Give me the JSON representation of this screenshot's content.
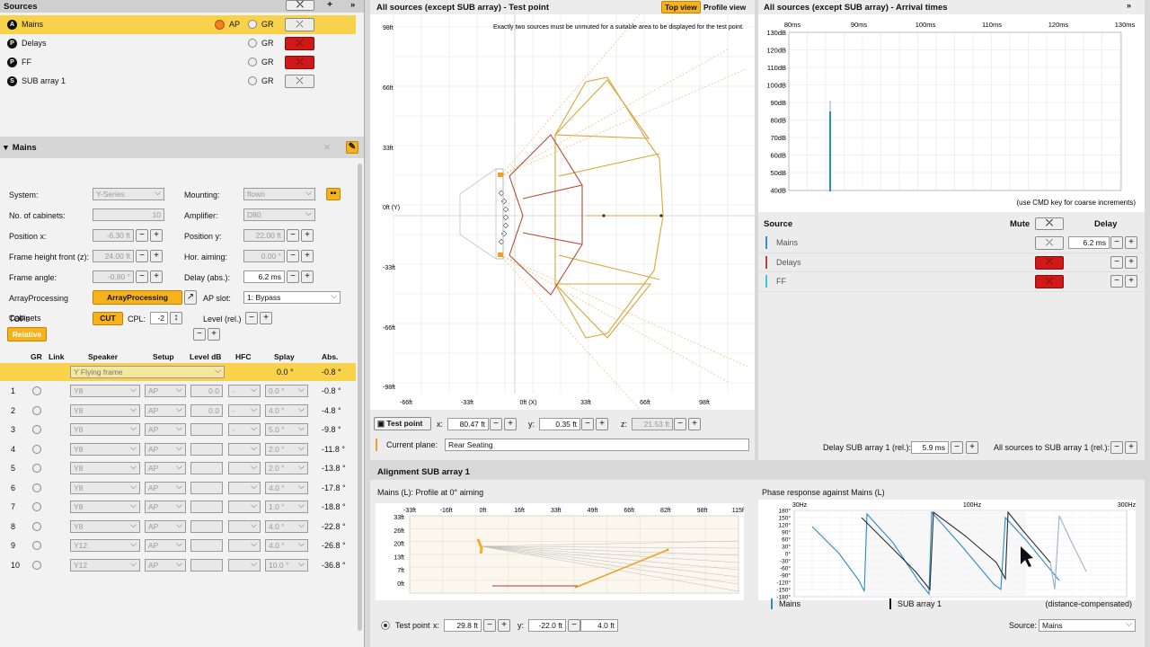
{
  "sources": {
    "title": "Sources",
    "items": [
      {
        "badge": "A",
        "name": "Mains",
        "ap": "AP",
        "gr": "GR",
        "selected": true
      },
      {
        "badge": "P",
        "name": "Delays",
        "gr": "GR"
      },
      {
        "badge": "P",
        "name": "FF",
        "gr": "GR"
      },
      {
        "badge": "S",
        "name": "SUB array 1",
        "gr": "GR"
      }
    ]
  },
  "mains": {
    "title": "Mains",
    "system_label": "System:",
    "system": "Y-Series",
    "mounting_label": "Mounting:",
    "mounting": "flown",
    "cabinets_label": "No. of cabinets:",
    "cabinets": "10",
    "amplifier_label": "Amplifier:",
    "amplifier": "D80",
    "posx_label": "Position x:",
    "posx": "-6.30 ft",
    "posy_label": "Position y:",
    "posy": "22.00 ft",
    "fh_label": "Frame height front (z):",
    "fh": "24.00 ft",
    "hor_label": "Hor. aiming:",
    "hor": "0.00 °",
    "fa_label": "Frame angle:",
    "fa": "-0.80 °",
    "delay_label": "Delay (abs.):",
    "delay": "6.2 ms",
    "ap_label": "ArrayProcessing",
    "ap_btn": "ArrayProcessing",
    "slot_label": "AP slot:",
    "slot": "1: Bypass",
    "tops_label": "TOPs",
    "cut": "CUT",
    "cpl_label": "CPL:",
    "cpl": "-2",
    "level_label": "Level (rel.)",
    "cabinets_title": "Cabinets",
    "relative": "Relative",
    "table_headers": [
      "GR",
      "Link",
      "Speaker",
      "Setup",
      "Level dB",
      "HFC",
      "Splay",
      "Abs."
    ],
    "frame_row": {
      "speaker": "Y Flying frame",
      "splay": "0.0 °",
      "abs": "-0.8 °"
    },
    "rows": [
      {
        "n": "1",
        "speaker": "Y8",
        "setup": "AP",
        "level": "0.0",
        "hfc": "-",
        "splay": "0.0 °",
        "abs": "-0.8 °"
      },
      {
        "n": "2",
        "speaker": "Y8",
        "setup": "AP",
        "level": "0.0",
        "hfc": "-",
        "splay": "4.0 °",
        "abs": "-4.8 °"
      },
      {
        "n": "3",
        "speaker": "Y8",
        "setup": "AP",
        "level": "",
        "hfc": "-",
        "splay": "5.0 °",
        "abs": "-9.8 °"
      },
      {
        "n": "4",
        "speaker": "Y8",
        "setup": "AP",
        "level": "",
        "hfc": "",
        "splay": "2.0 °",
        "abs": "-11.8 °"
      },
      {
        "n": "5",
        "speaker": "Y8",
        "setup": "AP",
        "level": "",
        "hfc": "",
        "splay": "2.0 °",
        "abs": "-13.8 °"
      },
      {
        "n": "6",
        "speaker": "Y8",
        "setup": "AP",
        "level": "",
        "hfc": "",
        "splay": "4.0 °",
        "abs": "-17.8 °"
      },
      {
        "n": "7",
        "speaker": "Y8",
        "setup": "AP",
        "level": "",
        "hfc": "",
        "splay": "1.0 °",
        "abs": "-18.8 °"
      },
      {
        "n": "8",
        "speaker": "Y8",
        "setup": "AP",
        "level": "",
        "hfc": "",
        "splay": "4.0 °",
        "abs": "-22.8 °"
      },
      {
        "n": "9",
        "speaker": "Y12",
        "setup": "AP",
        "level": "",
        "hfc": "",
        "splay": "4.0 °",
        "abs": "-26.8 °"
      },
      {
        "n": "10",
        "speaker": "Y12",
        "setup": "AP",
        "level": "",
        "hfc": "",
        "splay": "10.0 °",
        "abs": "-36.8 °"
      }
    ]
  },
  "topview": {
    "title": "All sources (except SUB array) - Test point",
    "tab_top": "Top view",
    "tab_profile": "Profile view",
    "note": "Exactly two sources must be unmuted for a suitable area to be displayed for the test point.",
    "y_ticks": [
      "98ft",
      "66ft",
      "33ft",
      "0ft (Y)",
      "-33ft",
      "-66ft",
      "-98ft"
    ],
    "x_ticks": [
      "-66ft",
      "-33ft",
      "0ft (X)",
      "33ft",
      "66ft",
      "98ft"
    ],
    "testpoint_label": "Test point",
    "x_label": "x:",
    "x": "80.47 ft",
    "y_label": "y:",
    "y": "0.35 ft",
    "z_label": "z:",
    "z": "21.53 ft",
    "plane_label": "Current plane:",
    "plane": "Rear Seating"
  },
  "arrival": {
    "title": "All sources (except SUB array) - Arrival times",
    "x_ticks": [
      "80ms",
      "90ms",
      "100ms",
      "110ms",
      "120ms",
      "130ms"
    ],
    "y_ticks": [
      "130dB",
      "120dB",
      "110dB",
      "100dB",
      "90dB",
      "80dB",
      "70dB",
      "60dB",
      "50dB",
      "40dB"
    ],
    "hint": "(use CMD key for coarse increments)",
    "source_hdr": "Source",
    "mute_hdr": "Mute",
    "delay_hdr": "Delay",
    "rows": [
      {
        "name": "Mains",
        "color": "#3a8fc4",
        "delay": "6.2 ms"
      },
      {
        "name": "Delays",
        "color": "#b84040"
      },
      {
        "name": "FF",
        "color": "#40c8d8"
      }
    ],
    "delay_sub_label": "Delay SUB array 1 (rel.):",
    "delay_sub": "5.9 ms",
    "all_sources_label": "All sources to SUB array 1 (rel.):"
  },
  "alignment": {
    "title": "Alignment SUB array 1",
    "profile_title": "Mains (L): Profile at 0° aiming",
    "p_x_ticks": [
      "-33ft",
      "-16ft",
      "0ft",
      "16ft",
      "33ft",
      "49ft",
      "66ft",
      "82ft",
      "98ft",
      "115ft"
    ],
    "p_y_ticks": [
      "33ft",
      "26ft",
      "20ft",
      "13ft",
      "7ft",
      "0ft"
    ],
    "phase_title": "Phase response against Mains (L)",
    "f_ticks": [
      "30Hz",
      "100Hz",
      "300Hz"
    ],
    "deg_ticks": [
      "180°",
      "150°",
      "120°",
      "90°",
      "60°",
      "30°",
      "0°",
      "-30°",
      "-60°",
      "-90°",
      "-120°",
      "-150°",
      "-180°"
    ],
    "legend_mains": "Mains",
    "legend_sub": "SUB array 1",
    "comp": "(distance-compensated)",
    "tp_label": "Test point",
    "x_label": "x:",
    "x": "29.8 ft",
    "y_label": "y:",
    "y": "-22.0 ft",
    "z_label": "z:",
    "z": "4.0 ft",
    "source_label": "Source:",
    "source": "Mains"
  }
}
